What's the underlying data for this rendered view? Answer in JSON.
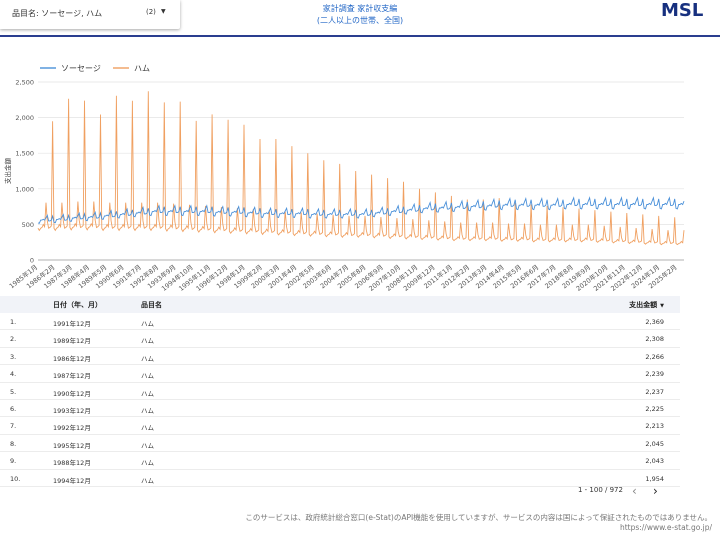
{
  "filter": {
    "label": "品目名: ソーセージ, ハム",
    "count": "(2)"
  },
  "header": {
    "title_line1": "家計調査 家計収支編",
    "title_line2": "(二人以上の世帯、全国)",
    "logo": "MSL"
  },
  "chart_data": {
    "type": "line",
    "ylabel": "支出金額",
    "ylim": [
      0,
      2500
    ],
    "yticks": [
      "0",
      "500",
      "1,000",
      "1,500",
      "2,000",
      "2,500"
    ],
    "x_tick_labels": [
      "1985年1月",
      "1986年2月",
      "1987年3月",
      "1988年4月",
      "1989年5月",
      "1990年6月",
      "1991年7月",
      "1992年8月",
      "1993年9月",
      "1994年10月",
      "1995年11月",
      "1996年12月",
      "1998年1月",
      "1999年2月",
      "2000年3月",
      "2001年4月",
      "2002年5月",
      "2003年6月",
      "2004年7月",
      "2005年8月",
      "2006年9月",
      "2007年10月",
      "2008年11月",
      "2009年12月",
      "2011年1月",
      "2012年2月",
      "2013年3月",
      "2014年4月",
      "2015年5月",
      "2016年6月",
      "2017年7月",
      "2018年8月",
      "2019年9月",
      "2020年10月",
      "2021年11月",
      "2022年12月",
      "2024年1月",
      "2025年2月"
    ],
    "x_start": "1985-01",
    "x_end": "2025-07",
    "legend": "top-left",
    "colors": {
      "ソーセージ": "#4a90d9",
      "ハム": "#f0a061"
    },
    "series": [
      {
        "name": "ソーセージ",
        "annual_base": [
          560,
          570,
          590,
          600,
          620,
          640,
          660,
          680,
          680,
          680,
          680,
          670,
          670,
          660,
          650,
          650,
          650,
          640,
          640,
          640,
          640,
          660,
          680,
          700,
          720,
          730,
          740,
          750,
          760,
          770,
          770,
          770,
          770,
          780,
          780,
          780,
          780,
          780,
          780,
          780,
          780
        ]
      },
      {
        "name": "ハム",
        "december_peak": [
          1950,
          2266,
          2239,
          2043,
          2308,
          2237,
          2369,
          2213,
          2225,
          1954,
          2045,
          1970,
          1900,
          1700,
          1700,
          1600,
          1500,
          1400,
          1350,
          1250,
          1200,
          1150,
          1100,
          1000,
          950,
          900,
          850,
          850,
          870,
          800,
          780,
          760,
          740,
          720,
          700,
          680,
          660,
          640,
          620,
          600,
          500
        ],
        "annual_base": [
          520,
          520,
          530,
          530,
          520,
          520,
          520,
          520,
          510,
          500,
          490,
          480,
          470,
          460,
          450,
          440,
          430,
          420,
          410,
          400,
          400,
          390,
          380,
          370,
          360,
          350,
          340,
          340,
          340,
          330,
          330,
          320,
          320,
          320,
          320,
          310,
          300,
          290,
          280,
          270,
          270
        ]
      }
    ]
  },
  "table": {
    "headers": {
      "date": "日付（年、月）",
      "item": "品目名",
      "value": "支出金額"
    },
    "rows": [
      {
        "no": "1.",
        "date": "1991年12月",
        "item": "ハム",
        "value": "2,369"
      },
      {
        "no": "2.",
        "date": "1989年12月",
        "item": "ハム",
        "value": "2,308"
      },
      {
        "no": "3.",
        "date": "1986年12月",
        "item": "ハム",
        "value": "2,266"
      },
      {
        "no": "4.",
        "date": "1987年12月",
        "item": "ハム",
        "value": "2,239"
      },
      {
        "no": "5.",
        "date": "1990年12月",
        "item": "ハム",
        "value": "2,237"
      },
      {
        "no": "6.",
        "date": "1993年12月",
        "item": "ハム",
        "value": "2,225"
      },
      {
        "no": "7.",
        "date": "1992年12月",
        "item": "ハム",
        "value": "2,213"
      },
      {
        "no": "8.",
        "date": "1995年12月",
        "item": "ハム",
        "value": "2,045"
      },
      {
        "no": "9.",
        "date": "1988年12月",
        "item": "ハム",
        "value": "2,043"
      },
      {
        "no": "10.",
        "date": "1994年12月",
        "item": "ハム",
        "value": "1,954"
      }
    ]
  },
  "pager": {
    "text": "1 - 100 / 972"
  },
  "footer": {
    "note": "このサービスは、政府統計総合窓口(e-Stat)のAPI機能を使用していますが、サービスの内容は国によって保証されたものではありません。",
    "url": "https://www.e-stat.go.jp/"
  }
}
